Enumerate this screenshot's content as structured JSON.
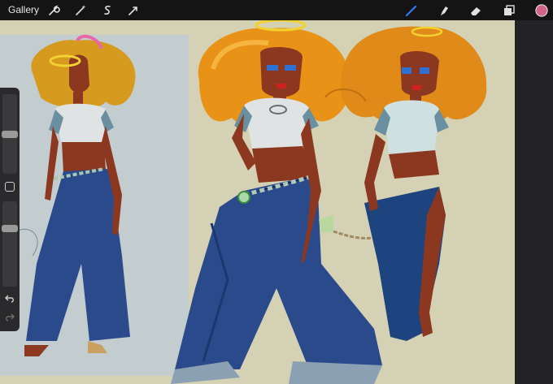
{
  "toolbar": {
    "gallery_label": "Gallery",
    "left_tools": [
      "wrench-icon",
      "magic-wand-icon",
      "selection-icon",
      "transform-icon"
    ],
    "right_tools": [
      "brush-icon",
      "smudge-icon",
      "eraser-icon",
      "layers-icon"
    ],
    "active_tool": "brush",
    "accent_color": "#2f7bf5",
    "current_color": "#d0658a"
  },
  "sidebar": {
    "brush_size_level": 0.5,
    "opacity_level": 0.3
  },
  "canvas": {
    "background_color": "#d4d1b4",
    "reference_panel_color": "#c3cdcf"
  }
}
